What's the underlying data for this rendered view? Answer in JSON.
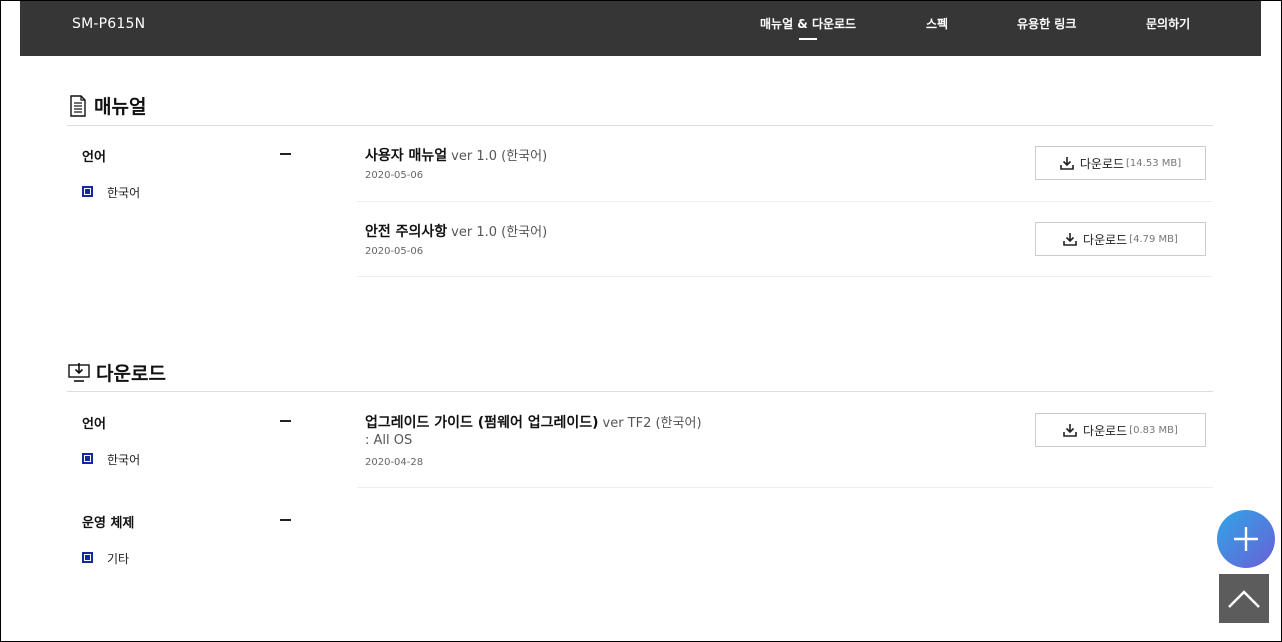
{
  "header": {
    "model": "SM-P615N",
    "nav": [
      {
        "label": "매뉴얼 & 다운로드",
        "active": true
      },
      {
        "label": "스펙"
      },
      {
        "label": "유용한 링크"
      },
      {
        "label": "문의하기"
      }
    ]
  },
  "manual_section": {
    "title": "매뉴얼",
    "icon": "document-icon",
    "filters": [
      {
        "label": "언어",
        "options": [
          "한국어"
        ]
      }
    ],
    "items": [
      {
        "title": "사용자 매뉴얼",
        "version": "ver 1.0 (한국어)",
        "date": "2020-05-06",
        "download_label": "다운로드",
        "size": "[14.53 MB]"
      },
      {
        "title": "안전 주의사항",
        "version": "ver 1.0 (한국어)",
        "date": "2020-05-06",
        "download_label": "다운로드",
        "size": "[4.79 MB]"
      }
    ]
  },
  "download_section": {
    "title": "다운로드",
    "icon": "download-monitor-icon",
    "filters": [
      {
        "label": "언어",
        "options": [
          "한국어"
        ]
      },
      {
        "label": "운영 체제",
        "options": [
          "기타"
        ]
      }
    ],
    "items": [
      {
        "title": "업그레이드 가이드 (펌웨어 업그레이드)",
        "version": "ver TF2 (한국어)",
        "subtitle": ": All OS",
        "date": "2020-04-28",
        "download_label": "다운로드",
        "size": "[0.83 MB]"
      }
    ]
  },
  "floating": {
    "plus_icon": "plus-icon",
    "top_icon": "chevron-up-icon"
  },
  "colors": {
    "header_bg": "#363636",
    "checkbox": "#1428a0",
    "fab_gradient_start": "#2fa6e6",
    "fab_gradient_end": "#6a5fd8",
    "top_button": "#5c5c5c"
  }
}
